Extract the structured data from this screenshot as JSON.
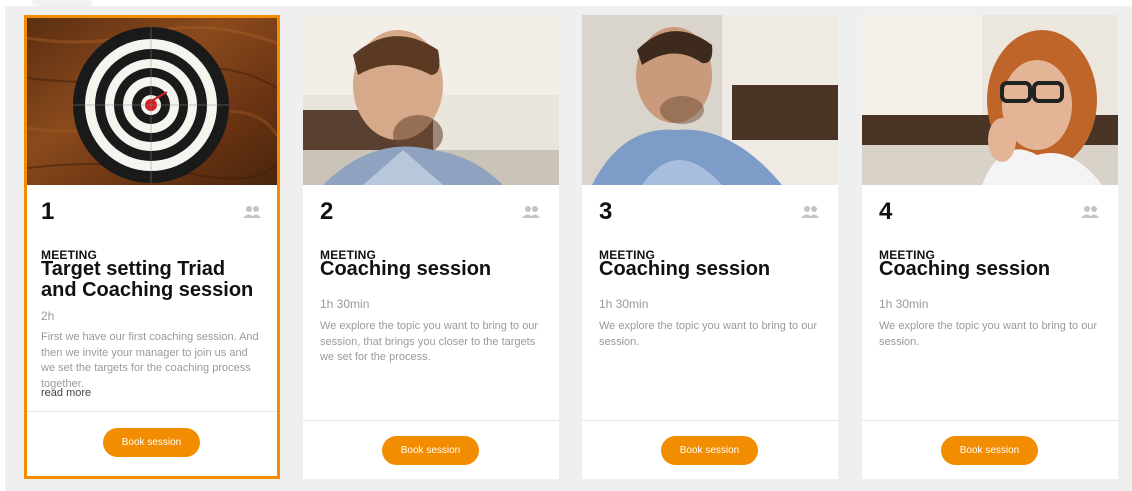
{
  "cards": [
    {
      "number": "1",
      "kind": "MEETING",
      "title": "Target setting Triad and Coaching session",
      "duration": "2h",
      "description": "First we have our first coaching session. And then we invite your manager to join us and we set the targets for the coaching process together.",
      "read_more": "read more",
      "button": "Book session",
      "photo": "dartboard-photo",
      "selected": true
    },
    {
      "number": "2",
      "kind": "MEETING",
      "title": "Coaching session",
      "duration": "1h 30min",
      "description": "We explore the topic you want to bring to our session, that brings you closer to the targets we set for the process.",
      "button": "Book session",
      "photo": "man-looking-down-photo"
    },
    {
      "number": "3",
      "kind": "MEETING",
      "title": "Coaching session",
      "duration": "1h 30min",
      "description": "We explore the topic you want to bring to our session.",
      "button": "Book session",
      "photo": "man-smiling-photo"
    },
    {
      "number": "4",
      "kind": "MEETING",
      "title": "Coaching session",
      "duration": "1h 30min",
      "description": "We explore the topic you want to bring to our session.",
      "button": "Book session",
      "photo": "woman-with-glasses-photo"
    }
  ],
  "colors": {
    "accent": "#f28c00",
    "panel_bg": "#efefef",
    "muted_text": "#9a9a9a"
  },
  "icons": {
    "group": "group-icon"
  }
}
